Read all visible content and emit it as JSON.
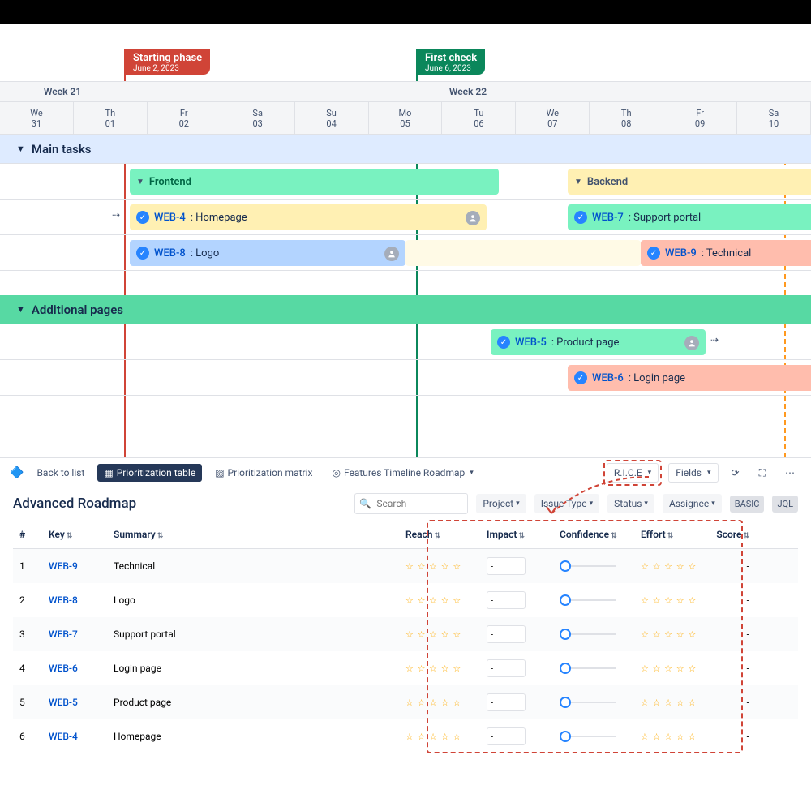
{
  "milestones": {
    "start": {
      "title": "Starting phase",
      "date": "June 2, 2023"
    },
    "check": {
      "title": "First check",
      "date": "June 6, 2023"
    }
  },
  "weeks": {
    "w21": "Week 21",
    "w22": "Week 22"
  },
  "days": [
    {
      "dow": "We",
      "num": "31"
    },
    {
      "dow": "Th",
      "num": "01"
    },
    {
      "dow": "Fr",
      "num": "02"
    },
    {
      "dow": "Sa",
      "num": "03"
    },
    {
      "dow": "Su",
      "num": "04"
    },
    {
      "dow": "Mo",
      "num": "05"
    },
    {
      "dow": "Tu",
      "num": "06"
    },
    {
      "dow": "We",
      "num": "07"
    },
    {
      "dow": "Th",
      "num": "08"
    },
    {
      "dow": "Fr",
      "num": "09"
    },
    {
      "dow": "Sa",
      "num": "10"
    }
  ],
  "groups": {
    "main": "Main tasks",
    "additional": "Additional pages"
  },
  "bars": {
    "frontend": "Frontend",
    "backend": "Backend",
    "web4": {
      "key": "WEB-4",
      "summary": ": Homepage"
    },
    "web7": {
      "key": "WEB-7",
      "summary": ": Support portal"
    },
    "web8": {
      "key": "WEB-8",
      "summary": ": Logo"
    },
    "web9": {
      "key": "WEB-9",
      "summary": ": Technical"
    },
    "web5": {
      "key": "WEB-5",
      "summary": ": Product page"
    },
    "web6": {
      "key": "WEB-6",
      "summary": ": Login page"
    }
  },
  "toolbar": {
    "back": "Back to list",
    "prio_table": "Prioritization table",
    "prio_matrix": "Prioritization matrix",
    "features_timeline": "Features Timeline Roadmap",
    "rice": "R.I.C.E",
    "fields": "Fields"
  },
  "page": {
    "title": "Advanced Roadmap",
    "search_placeholder": "Search"
  },
  "filters": {
    "project": "Project",
    "issue_type": "Issue Type",
    "status": "Status",
    "assignee": "Assignee",
    "basic": "BASIC",
    "jql": "JQL"
  },
  "columns": {
    "num": "#",
    "key": "Key",
    "summary": "Summary",
    "reach": "Reach",
    "impact": "Impact",
    "confidence": "Confidence",
    "effort": "Effort",
    "score": "Score"
  },
  "rows": [
    {
      "n": "1",
      "key": "WEB-9",
      "summary": "Technical",
      "impact": "-",
      "score": "-"
    },
    {
      "n": "2",
      "key": "WEB-8",
      "summary": "Logo",
      "impact": "-",
      "score": "-"
    },
    {
      "n": "3",
      "key": "WEB-7",
      "summary": "Support portal",
      "impact": "-",
      "score": "-"
    },
    {
      "n": "4",
      "key": "WEB-6",
      "summary": "Login page",
      "impact": "-",
      "score": "-"
    },
    {
      "n": "5",
      "key": "WEB-5",
      "summary": "Product page",
      "impact": "-",
      "score": "-"
    },
    {
      "n": "6",
      "key": "WEB-4",
      "summary": "Homepage",
      "impact": "-",
      "score": "-"
    }
  ]
}
